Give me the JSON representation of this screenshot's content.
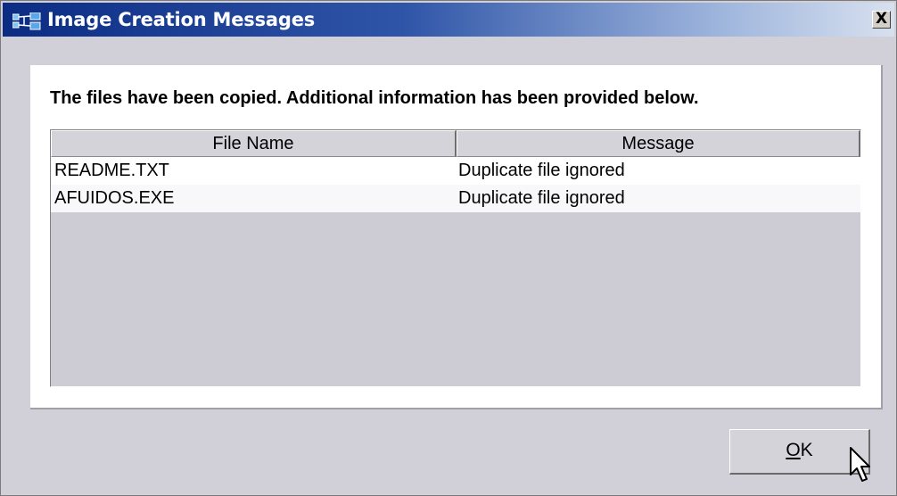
{
  "window": {
    "title": "Image Creation Messages",
    "close_glyph": "X"
  },
  "info_message": "The files have been copied.  Additional information has been provided below.",
  "table": {
    "columns": [
      "File Name",
      "Message"
    ],
    "rows": [
      {
        "file_name": "README.TXT",
        "message": "Duplicate file ignored"
      },
      {
        "file_name": "AFUIDOS.EXE",
        "message": "Duplicate file ignored"
      }
    ]
  },
  "buttons": {
    "ok_mnemonic": "O",
    "ok_rest": "K"
  },
  "icons": {
    "app": "network-icon",
    "close": "close-icon",
    "cursor": "arrow-cursor-icon"
  },
  "colors": {
    "title_start": "#0c2c84",
    "title_end": "#d7e0ef",
    "window_bg": "#d1d0d8"
  }
}
